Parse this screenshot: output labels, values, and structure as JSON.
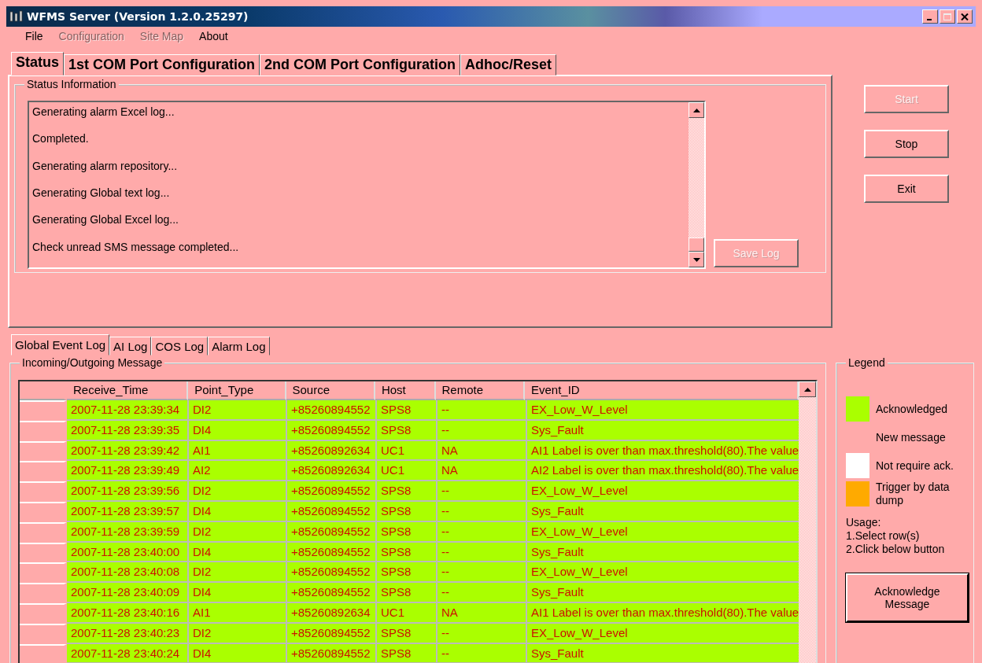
{
  "window": {
    "title": "WFMS Server (Version 1.2.0.25297)"
  },
  "menu": [
    {
      "label": "File",
      "disabled": false
    },
    {
      "label": "Configuration",
      "disabled": true
    },
    {
      "label": "Site Map",
      "disabled": true
    },
    {
      "label": "About",
      "disabled": false
    }
  ],
  "tabs": [
    {
      "label": "Status",
      "selected": true
    },
    {
      "label": "1st COM Port Configuration",
      "selected": false
    },
    {
      "label": "2nd COM Port Configuration",
      "selected": false
    },
    {
      "label": "Adhoc/Reset",
      "selected": false
    }
  ],
  "status_group": {
    "title": "Status Information",
    "log": [
      "Generating alarm Excel log...",
      "Completed.",
      "Generating alarm repository...",
      "Generating Global text log...",
      "Generating Global Excel log...",
      "Check unread SMS message completed..."
    ],
    "save_button": {
      "label": "Save Log",
      "disabled": true
    }
  },
  "side_buttons": [
    {
      "label": "Start",
      "disabled": true
    },
    {
      "label": "Stop",
      "disabled": false
    },
    {
      "label": "Exit",
      "disabled": false
    }
  ],
  "log_tabs": [
    {
      "label": "Global Event Log",
      "selected": true
    },
    {
      "label": "AI Log",
      "selected": false
    },
    {
      "label": "COS Log",
      "selected": false
    },
    {
      "label": "Alarm Log",
      "selected": false
    }
  ],
  "message_group": {
    "title": "Incoming/Outgoing Message",
    "columns": [
      "Receive_Time",
      "Point_Type",
      "Source",
      "Host",
      "Remote",
      "Event_ID"
    ],
    "rows": [
      {
        "acknowledged": true,
        "cells": [
          "2007-11-28 23:39:34",
          "DI2",
          "+85260894552",
          "SPS8",
          "--",
          "EX_Low_W_Level"
        ]
      },
      {
        "acknowledged": true,
        "cells": [
          "2007-11-28 23:39:35",
          "DI4",
          "+85260894552",
          "SPS8",
          "--",
          "Sys_Fault"
        ]
      },
      {
        "acknowledged": true,
        "cells": [
          "2007-11-28 23:39:42",
          "AI1",
          "+85260892634",
          "UC1",
          "NA",
          "AI1 Label is over than max.threshold(80).The value"
        ]
      },
      {
        "acknowledged": true,
        "cells": [
          "2007-11-28 23:39:49",
          "AI2",
          "+85260892634",
          "UC1",
          "NA",
          "AI2 Label is over than max.threshold(80).The value"
        ]
      },
      {
        "acknowledged": true,
        "cells": [
          "2007-11-28 23:39:56",
          "DI2",
          "+85260894552",
          "SPS8",
          "--",
          "EX_Low_W_Level"
        ]
      },
      {
        "acknowledged": true,
        "cells": [
          "2007-11-28 23:39:57",
          "DI4",
          "+85260894552",
          "SPS8",
          "--",
          "Sys_Fault"
        ]
      },
      {
        "acknowledged": true,
        "cells": [
          "2007-11-28 23:39:59",
          "DI2",
          "+85260894552",
          "SPS8",
          "--",
          "EX_Low_W_Level"
        ]
      },
      {
        "acknowledged": true,
        "cells": [
          "2007-11-28 23:40:00",
          "DI4",
          "+85260894552",
          "SPS8",
          "--",
          "Sys_Fault"
        ]
      },
      {
        "acknowledged": true,
        "cells": [
          "2007-11-28 23:40:08",
          "DI2",
          "+85260894552",
          "SPS8",
          "--",
          "EX_Low_W_Level"
        ]
      },
      {
        "acknowledged": true,
        "cells": [
          "2007-11-28 23:40:09",
          "DI4",
          "+85260894552",
          "SPS8",
          "--",
          "Sys_Fault"
        ]
      },
      {
        "acknowledged": true,
        "cells": [
          "2007-11-28 23:40:16",
          "AI1",
          "+85260892634",
          "UC1",
          "NA",
          "AI1 Label is over than max.threshold(80).The value"
        ]
      },
      {
        "acknowledged": true,
        "cells": [
          "2007-11-28 23:40:23",
          "DI2",
          "+85260894552",
          "SPS8",
          "--",
          "EX_Low_W_Level"
        ]
      },
      {
        "acknowledged": true,
        "cells": [
          "2007-11-28 23:40:24",
          "DI4",
          "+85260894552",
          "SPS8",
          "--",
          "Sys_Fault"
        ]
      }
    ]
  },
  "legend": {
    "title": "Legend",
    "items": [
      {
        "label": "Acknowledged",
        "color": "#aaff00"
      },
      {
        "label": "New message"
      },
      {
        "label": "Not require ack.",
        "color": "#ffffff"
      },
      {
        "label": "Trigger by data dump",
        "color": "#ffaa00"
      }
    ],
    "usage": [
      "Usage:",
      "1.Select row(s)",
      "2.Click below button"
    ],
    "button": "Acknowledge Message"
  }
}
